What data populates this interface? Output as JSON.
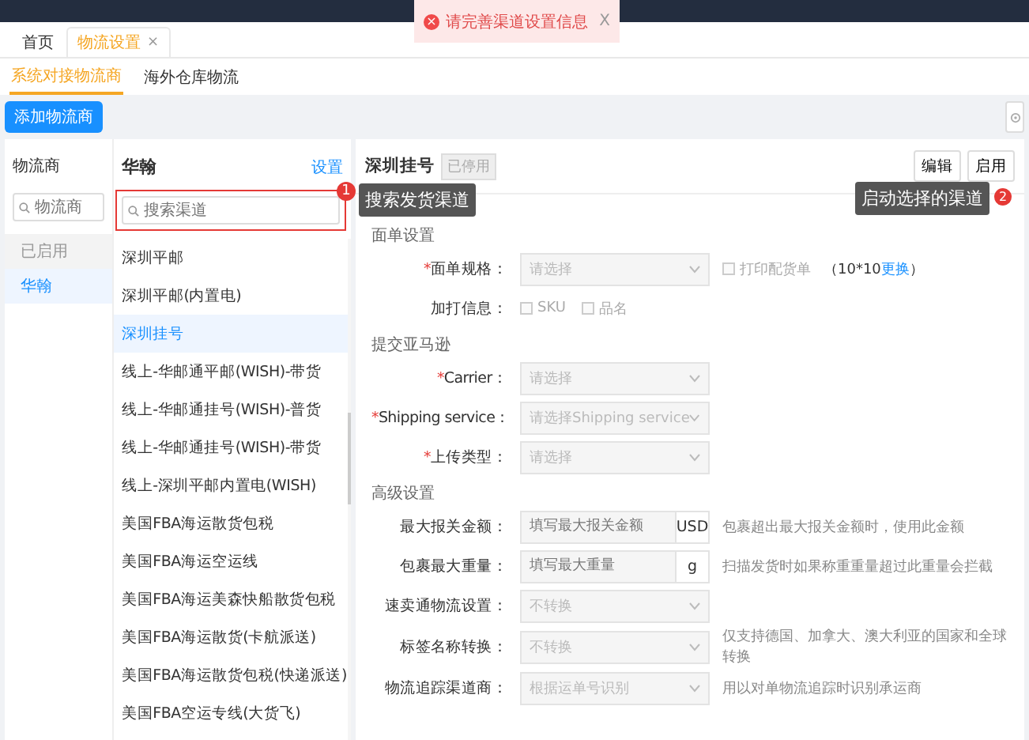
{
  "toast": {
    "icon": "×",
    "message": "请完善渠道设置信息",
    "close": "X"
  },
  "tabs": [
    {
      "label": "首页",
      "selected": false
    },
    {
      "label": "物流设置",
      "selected": true,
      "close": "×"
    }
  ],
  "subtabs": [
    {
      "label": "系统对接物流商",
      "selected": true
    },
    {
      "label": "海外仓库物流",
      "selected": false
    }
  ],
  "add_button": "添加物流商",
  "vendors": {
    "title": "物流商",
    "search": {
      "placeholder": "物流商"
    },
    "items": [
      {
        "label": "已启用",
        "kind": "group",
        "selected": false
      },
      {
        "label": "华翰",
        "kind": "item",
        "selected": true
      }
    ]
  },
  "channels": {
    "title": "华翰",
    "settings_link": "设置",
    "search": {
      "placeholder": "搜索渠道",
      "highlighted": true,
      "badge": "1"
    },
    "tooltip": "搜索发货渠道",
    "items": [
      {
        "label": "深圳平邮",
        "selected": false
      },
      {
        "label": "深圳平邮(内置电)",
        "selected": false
      },
      {
        "label": "深圳挂号",
        "selected": true
      },
      {
        "label": "线上-华邮通平邮(WISH)-带货",
        "selected": false
      },
      {
        "label": "线上-华邮通挂号(WISH)-普货",
        "selected": false
      },
      {
        "label": "线上-华邮通挂号(WISH)-带货",
        "selected": false
      },
      {
        "label": "线上-深圳平邮内置电(WISH)",
        "selected": false
      },
      {
        "label": "美国FBA海运散货包税",
        "selected": false
      },
      {
        "label": "美国FBA海运空运线",
        "selected": false
      },
      {
        "label": "美国FBA海运美森快船散货包税",
        "selected": false
      },
      {
        "label": "美国FBA海运散货(卡航派送)",
        "selected": false
      },
      {
        "label": "美国FBA海运散货包税(快递派送)",
        "selected": false
      },
      {
        "label": "美国FBA空运专线(大货飞)",
        "selected": false
      }
    ]
  },
  "detail": {
    "title": "深圳挂号",
    "status_tag": "已停用",
    "buttons": [
      {
        "label": "编辑"
      },
      {
        "label": "启用"
      }
    ],
    "tooltip": "启动选择的渠道",
    "tooltip_badge": "2",
    "sections": [
      {
        "title": "面单设置",
        "rows": [
          {
            "kind": "select",
            "required_mark": "*",
            "label": "面单规格：",
            "placeholder": "请选择",
            "disabled": true,
            "extra": {
              "checkbox": "打印配货单",
              "checked": false,
              "note": "（10*10",
              "link": "更换",
              "note_end": "）"
            }
          },
          {
            "kind": "checks",
            "label": "加打信息：",
            "options": [
              {
                "label": "SKU",
                "checked": false
              },
              {
                "label": "品名",
                "checked": false
              }
            ]
          }
        ]
      },
      {
        "title": "提交亚马逊",
        "rows": [
          {
            "kind": "select",
            "required_mark": "*",
            "label": "Carrier：",
            "placeholder": "请选择",
            "disabled": true
          },
          {
            "kind": "select",
            "required_mark": "*",
            "label": "Shipping service：",
            "placeholder": "请选择Shipping service",
            "disabled": true
          },
          {
            "kind": "select",
            "required_mark": "*",
            "label": "上传类型：",
            "placeholder": "请选择",
            "disabled": true
          }
        ]
      },
      {
        "title": "高级设置",
        "rows": [
          {
            "kind": "unit",
            "label": "最大报关金额：",
            "placeholder": "填写最大报关金额",
            "unit": "USD",
            "hint": "包裹超出最大报关金额时，使用此金额"
          },
          {
            "kind": "unit",
            "label": "包裹最大重量：",
            "placeholder": "填写最大重量",
            "unit": "g",
            "hint": "扫描发货时如果称重重量超过此重量会拦截"
          },
          {
            "kind": "select",
            "label": "速卖通物流设置：",
            "placeholder": "不转换",
            "disabled": true
          },
          {
            "kind": "select",
            "label": "标签名称转换：",
            "placeholder": "不转换",
            "disabled": true,
            "hint": "仅支持德国、加拿大、澳大利亚的国家和全球转换"
          },
          {
            "kind": "select",
            "label": "物流追踪渠道商：",
            "placeholder": "根据运单号识别",
            "disabled": true,
            "hint": "用以对单物流追踪时识别承运商"
          }
        ]
      }
    ]
  }
}
